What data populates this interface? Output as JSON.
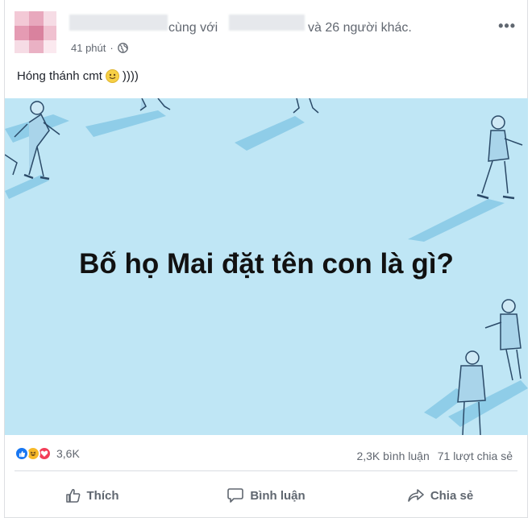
{
  "post": {
    "with_text": "cùng với",
    "others_text": "và 26 người khác.",
    "timestamp": "41 phút",
    "separator": "·",
    "caption": "Hóng thánh cmt",
    "caption_suffix": "))))",
    "image_question": "Bố họ Mai đặt tên con là gì?",
    "more_menu": "•••"
  },
  "stats": {
    "reaction_count": "3,6K",
    "comments": "2,3K bình luận",
    "shares": "71 lượt chia sẻ"
  },
  "actions": {
    "like": "Thích",
    "comment": "Bình luận",
    "share": "Chia sẻ"
  },
  "colors": {
    "image_bg": "#bfe6f5",
    "like_blue": "#1877f2",
    "haha_yellow": "#f7b928",
    "love_red": "#f33e58"
  }
}
